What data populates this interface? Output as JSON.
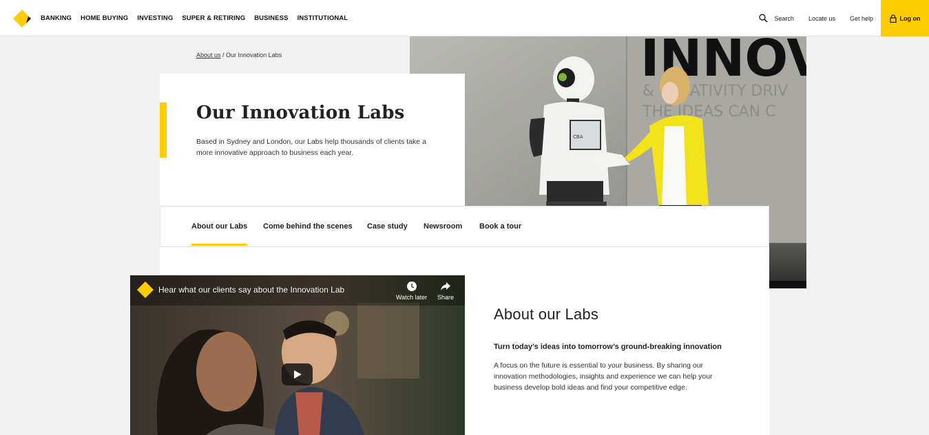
{
  "header": {
    "nav": [
      "BANKING",
      "HOME BUYING",
      "INVESTING",
      "SUPER & RETIRING",
      "BUSINESS",
      "INSTITUTIONAL"
    ],
    "search_label": "Search",
    "locate_label": "Locate us",
    "help_label": "Get help",
    "logon_label": "Log on"
  },
  "breadcrumb": {
    "parent": "About us",
    "separator": " / ",
    "current": "Our Innovation Labs"
  },
  "hero": {
    "title": "Our Innovation Labs",
    "description": "Based in Sydney and London, our Labs help thousands of clients take a more innovative approach to business each year.",
    "photo_wall_text": "INNOV",
    "photo_wall_sub1": "& CREATIVITY DRIV",
    "photo_wall_sub2": "THE IDEAS CAN C",
    "photo_screen_text": "CBA"
  },
  "tabs": [
    "About our Labs",
    "Come behind the scenes",
    "Case study",
    "Newsroom",
    "Book a tour"
  ],
  "video": {
    "title": "Hear what our clients say about the Innovation Lab",
    "watch_later": "Watch later",
    "share": "Share"
  },
  "about": {
    "title": "About our Labs",
    "subtitle": "Turn today’s ideas into tomorrow’s ground-breaking innovation",
    "body": "A focus on the future is essential to your business. By sharing our innovation methodologies, insights and experience we can help your business develop bold ideas and find your competitive edge."
  },
  "colors": {
    "brand_yellow": "#ffcc00",
    "text": "#222222"
  }
}
